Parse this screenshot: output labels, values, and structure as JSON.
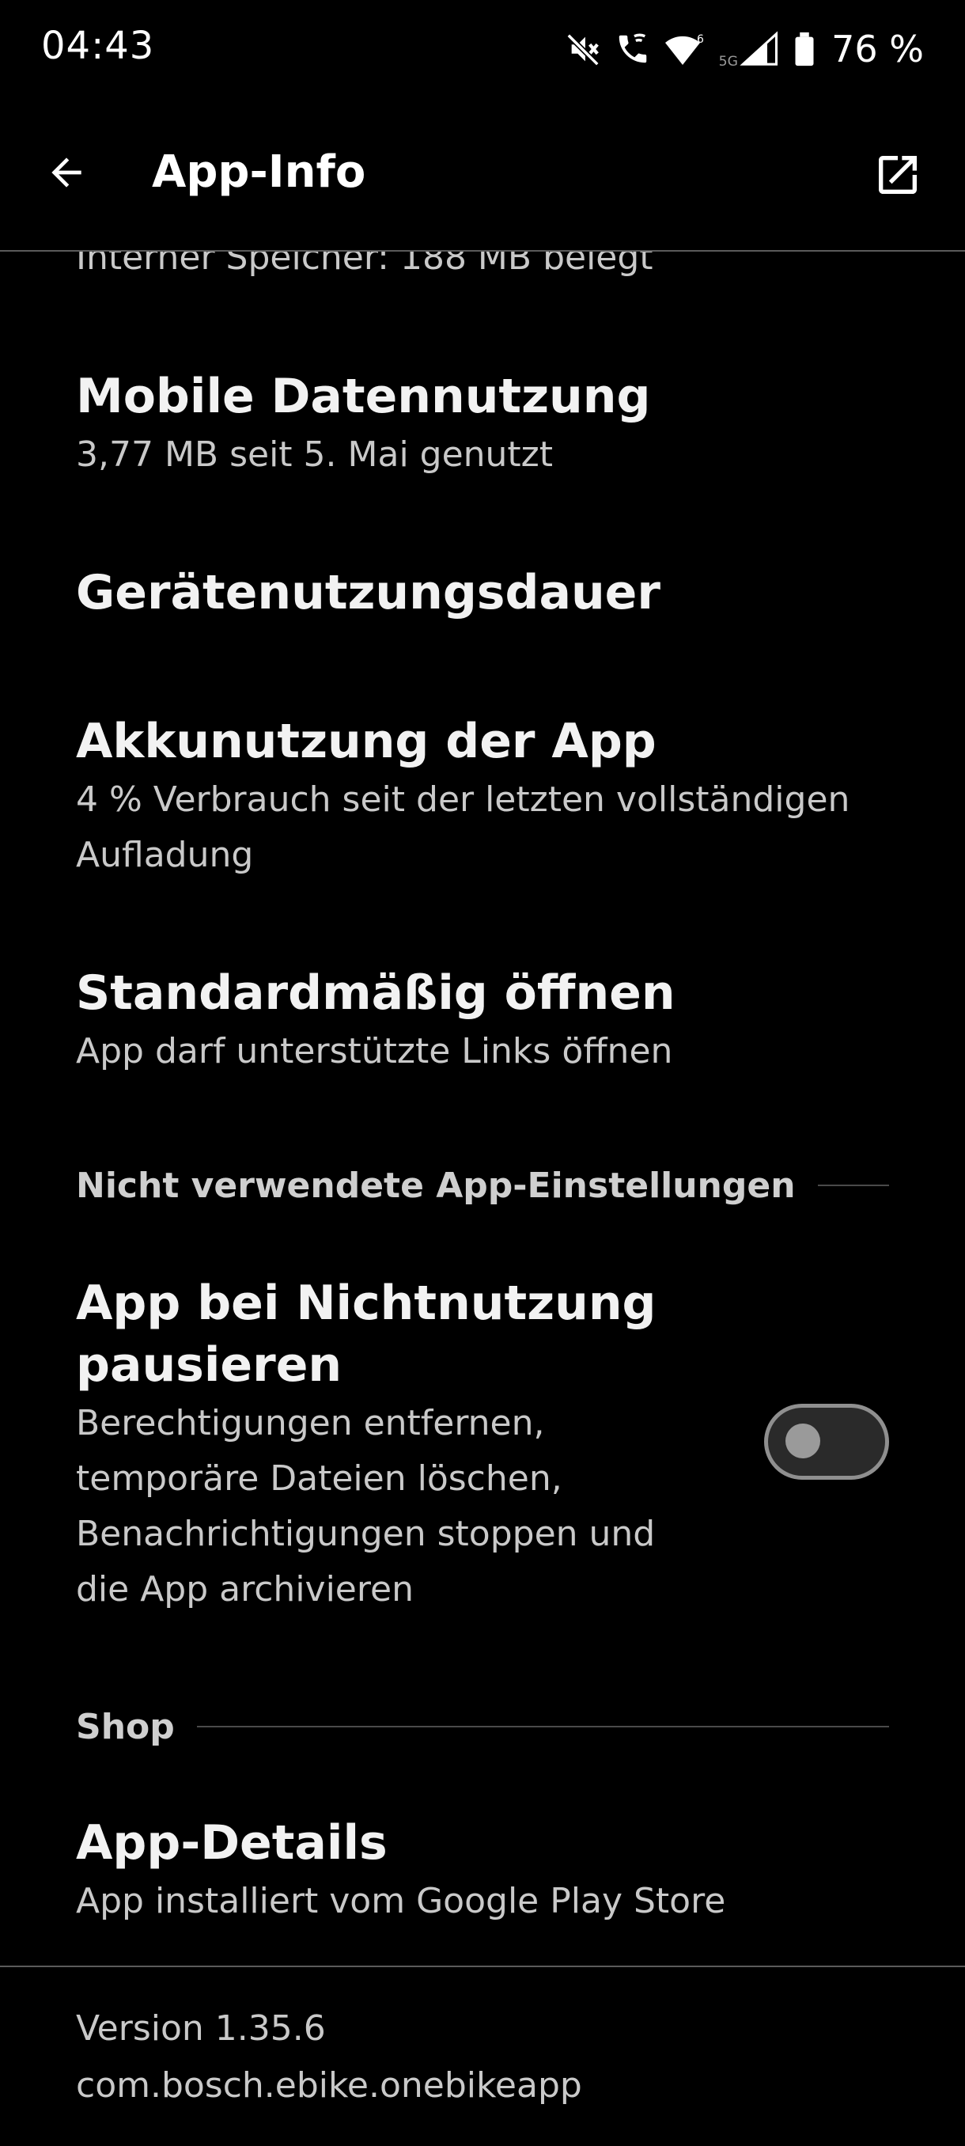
{
  "status_bar": {
    "time": "04:43",
    "battery_percent": "76 %",
    "network_label": "5G",
    "icons": [
      "mute-icon",
      "wifi-calling-icon",
      "wifi-6-icon",
      "cellular-5g-icon",
      "battery-icon"
    ]
  },
  "app_bar": {
    "title": "App-Info",
    "back_icon": "arrow-back-icon",
    "open_icon": "open-external-icon"
  },
  "storage": {
    "summary": "Interner Speicher: 188 MB belegt"
  },
  "items": {
    "mobile_data": {
      "title": "Mobile Datennutzung",
      "summary": "3,77 MB seit 5. Mai genutzt"
    },
    "screen_time": {
      "title": "Gerätenutzungsdauer"
    },
    "battery": {
      "title": "Akkunutzung der App",
      "summary_line1": "4 % Verbrauch seit der letzten vollständigen",
      "summary_line2": "Aufladung"
    },
    "open_default": {
      "title": "Standardmäßig öffnen",
      "summary": "App darf unterstützte Links öffnen"
    },
    "pause_app": {
      "title_line1": "App bei Nichtnutzung",
      "title_line2": "pausieren",
      "summary_line1": "Berechtigungen entfernen,",
      "summary_line2": "temporäre Dateien löschen,",
      "summary_line3": "Benachrichtigungen stoppen und",
      "summary_line4": "die App archivieren",
      "toggle_on": false
    },
    "app_details": {
      "title": "App-Details",
      "summary": "App installiert vom Google Play Store"
    }
  },
  "sections": {
    "unused": "Nicht verwendete App-Einstellungen",
    "shop": "Shop"
  },
  "footer": {
    "version": "Version 1.35.6",
    "package": "com.bosch.ebike.onebikeapp"
  },
  "colors": {
    "background": "#000000",
    "title_text": "#f2f2f2",
    "summary_text": "#c9c9c9",
    "divider": "#5a5a5a"
  }
}
